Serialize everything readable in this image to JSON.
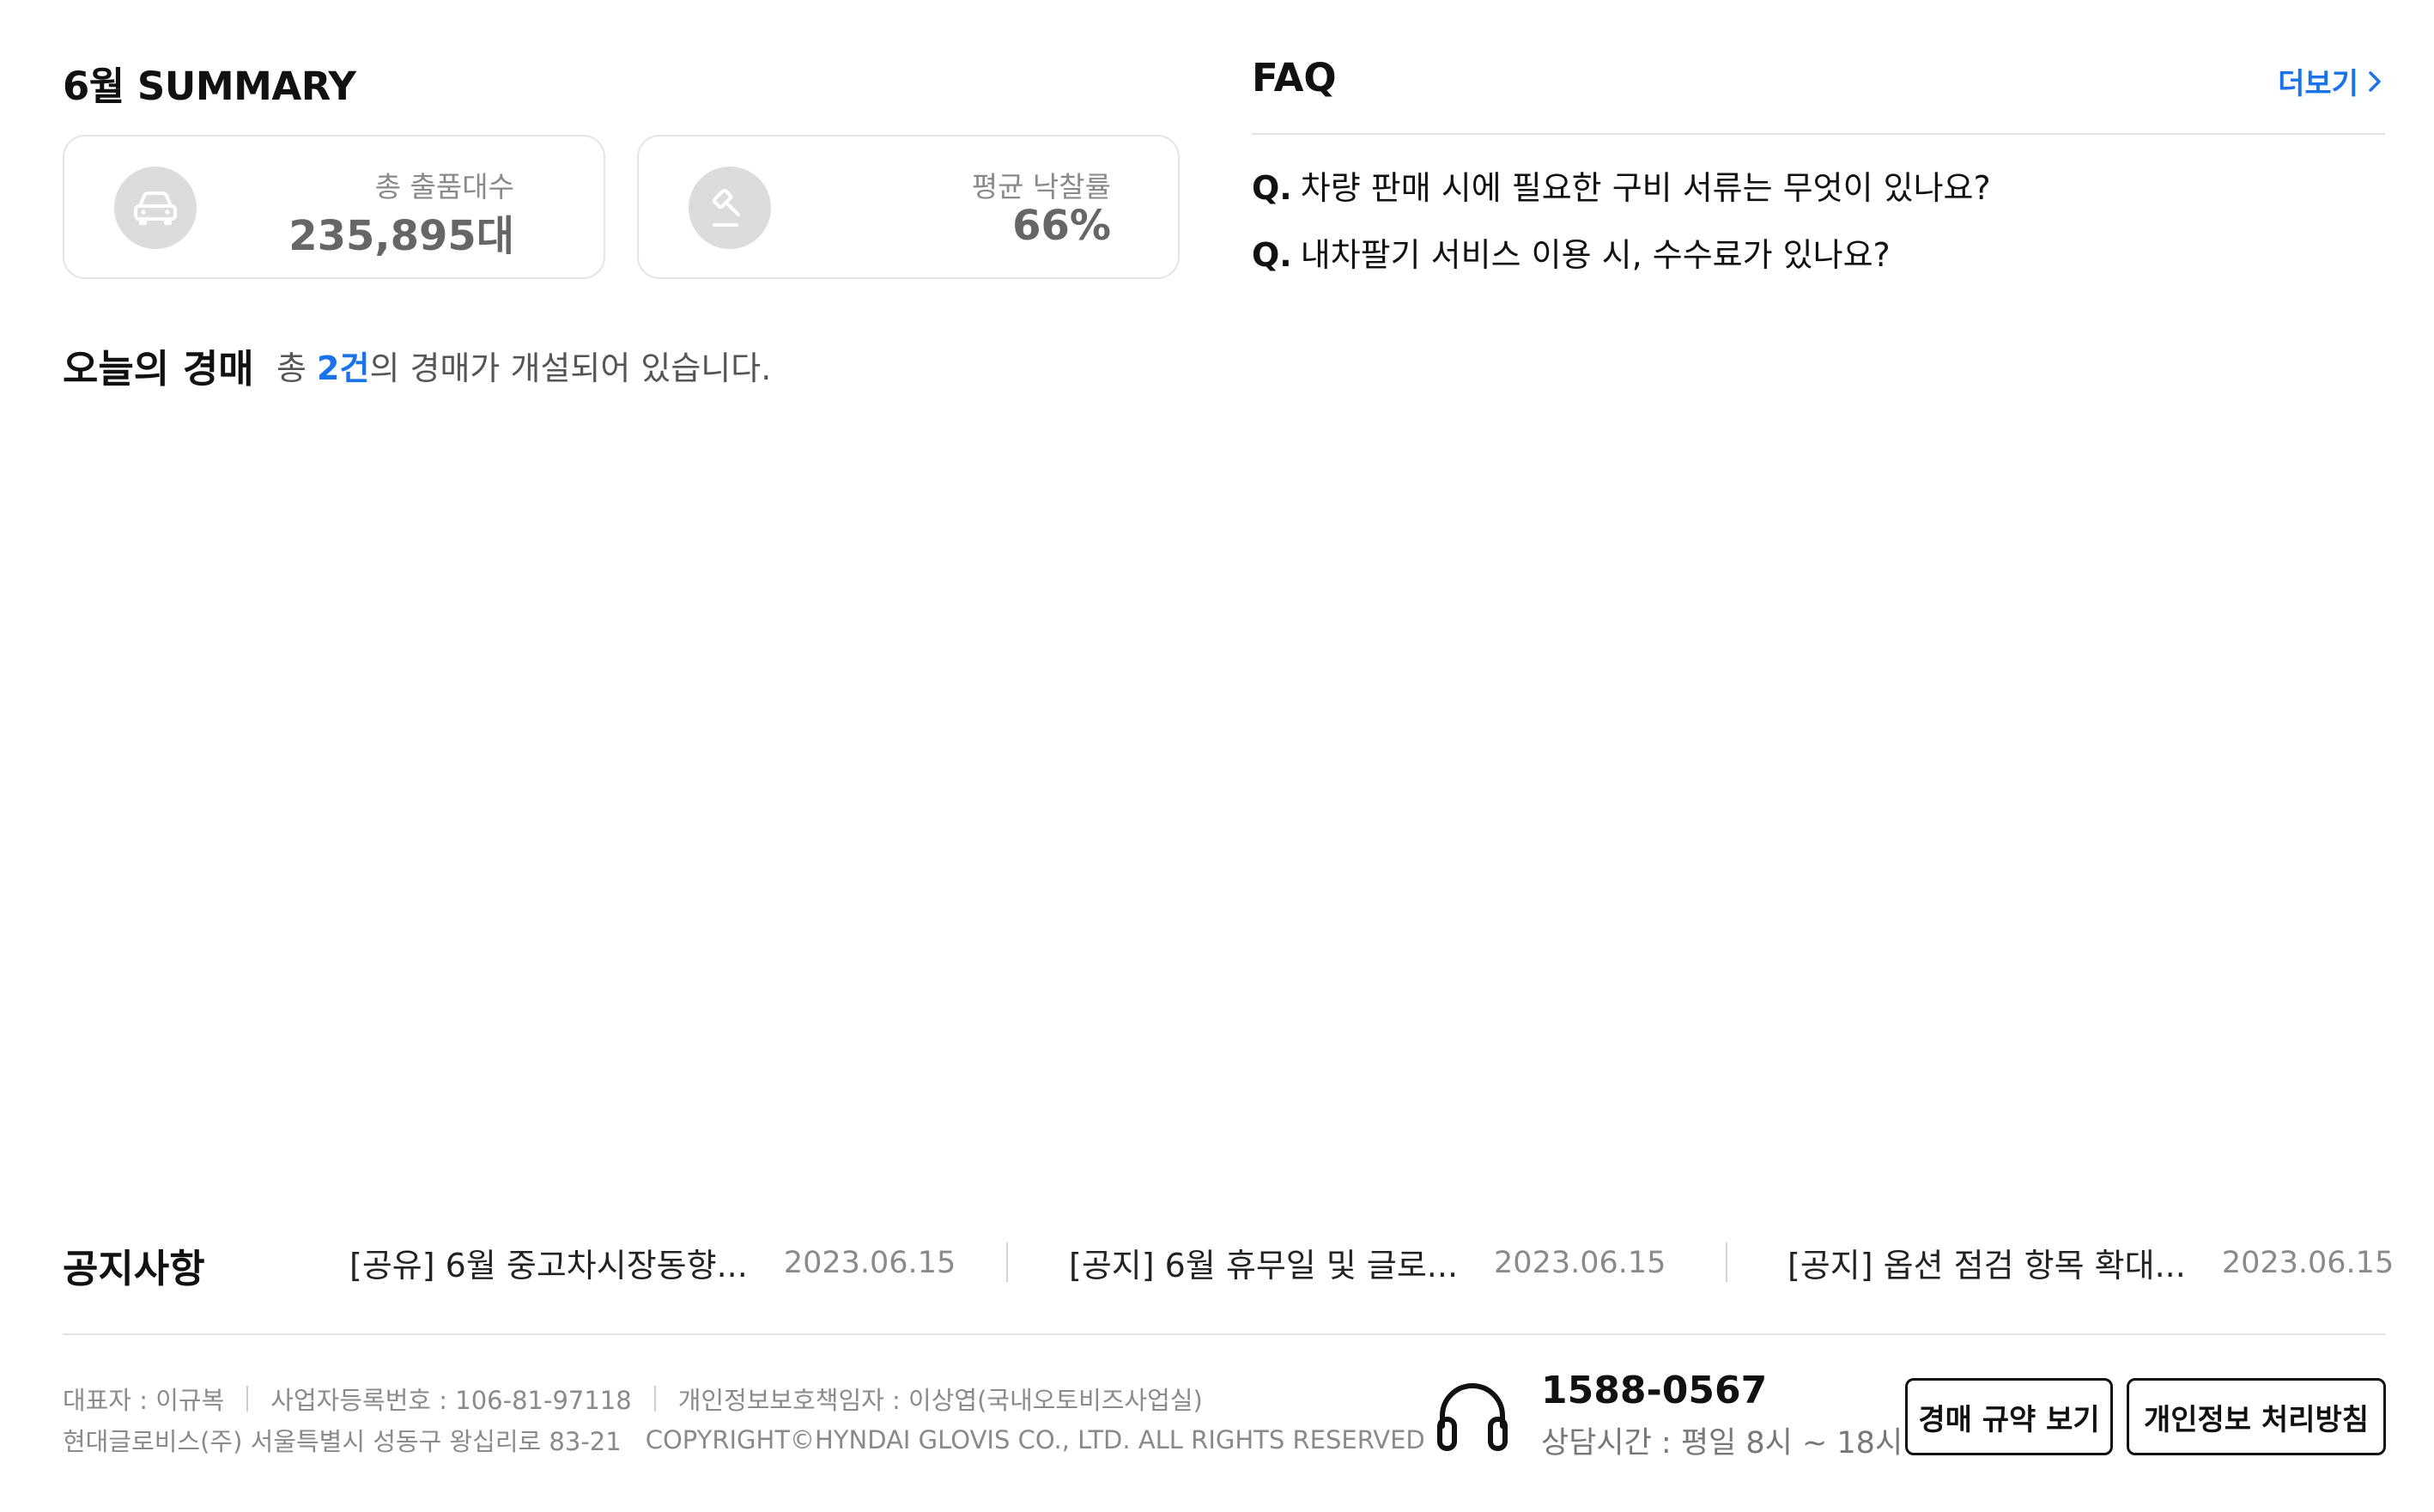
{
  "summary": {
    "title": "6월 SUMMARY",
    "cards": [
      {
        "icon": "car-icon",
        "label": "총 출품대수",
        "value": "235,895대"
      },
      {
        "icon": "gavel-icon",
        "label": "평균 낙찰률",
        "value": "66%"
      }
    ]
  },
  "faq": {
    "title": "FAQ",
    "more_label": "더보기",
    "items": [
      {
        "prefix": "Q.",
        "question": "차량 판매 시에 필요한 구비 서류는 무엇이 있나요?"
      },
      {
        "prefix": "Q.",
        "question": "내차팔기 서비스 이용 시, 수수료가 있나요?"
      }
    ]
  },
  "today": {
    "title": "오늘의 경매",
    "desc_prefix": "총 ",
    "count": "2건",
    "desc_suffix": "의 경매가 개설되어 있습니다."
  },
  "notice": {
    "title": "공지사항",
    "items": [
      {
        "title": "[공유] 6월 중고차시장동향...",
        "date": "2023.06.15"
      },
      {
        "title": "[공지] 6월 휴무일 및 글로...",
        "date": "2023.06.15"
      },
      {
        "title": "[공지] 옵션 점검 항목 확대...",
        "date": "2023.06.15"
      }
    ]
  },
  "footer": {
    "ceo": "대표자 : 이규복",
    "biz_no": "사업자등록번호 : 106-81-97118",
    "privacy_officer": "개인정보보호책임자 : 이상엽(국내오토비즈사업실)",
    "address": "현대글로비스(주) 서울특별시 성동구 왕십리로 83-21",
    "copyright": "COPYRIGHT©HYNDAI GLOVIS CO., LTD. ALL RIGHTS RESERVED",
    "cs_icon": "headset-icon",
    "phone": "1588-0567",
    "hours": "상담시간 : 평일 8시 ~ 18시",
    "rules_button": "경매 규약 보기",
    "privacy_button": "개인정보 처리방침"
  },
  "colors": {
    "accent": "#1a73e8",
    "icon_bg": "#dcdcdc",
    "border": "#e4e4e4"
  }
}
